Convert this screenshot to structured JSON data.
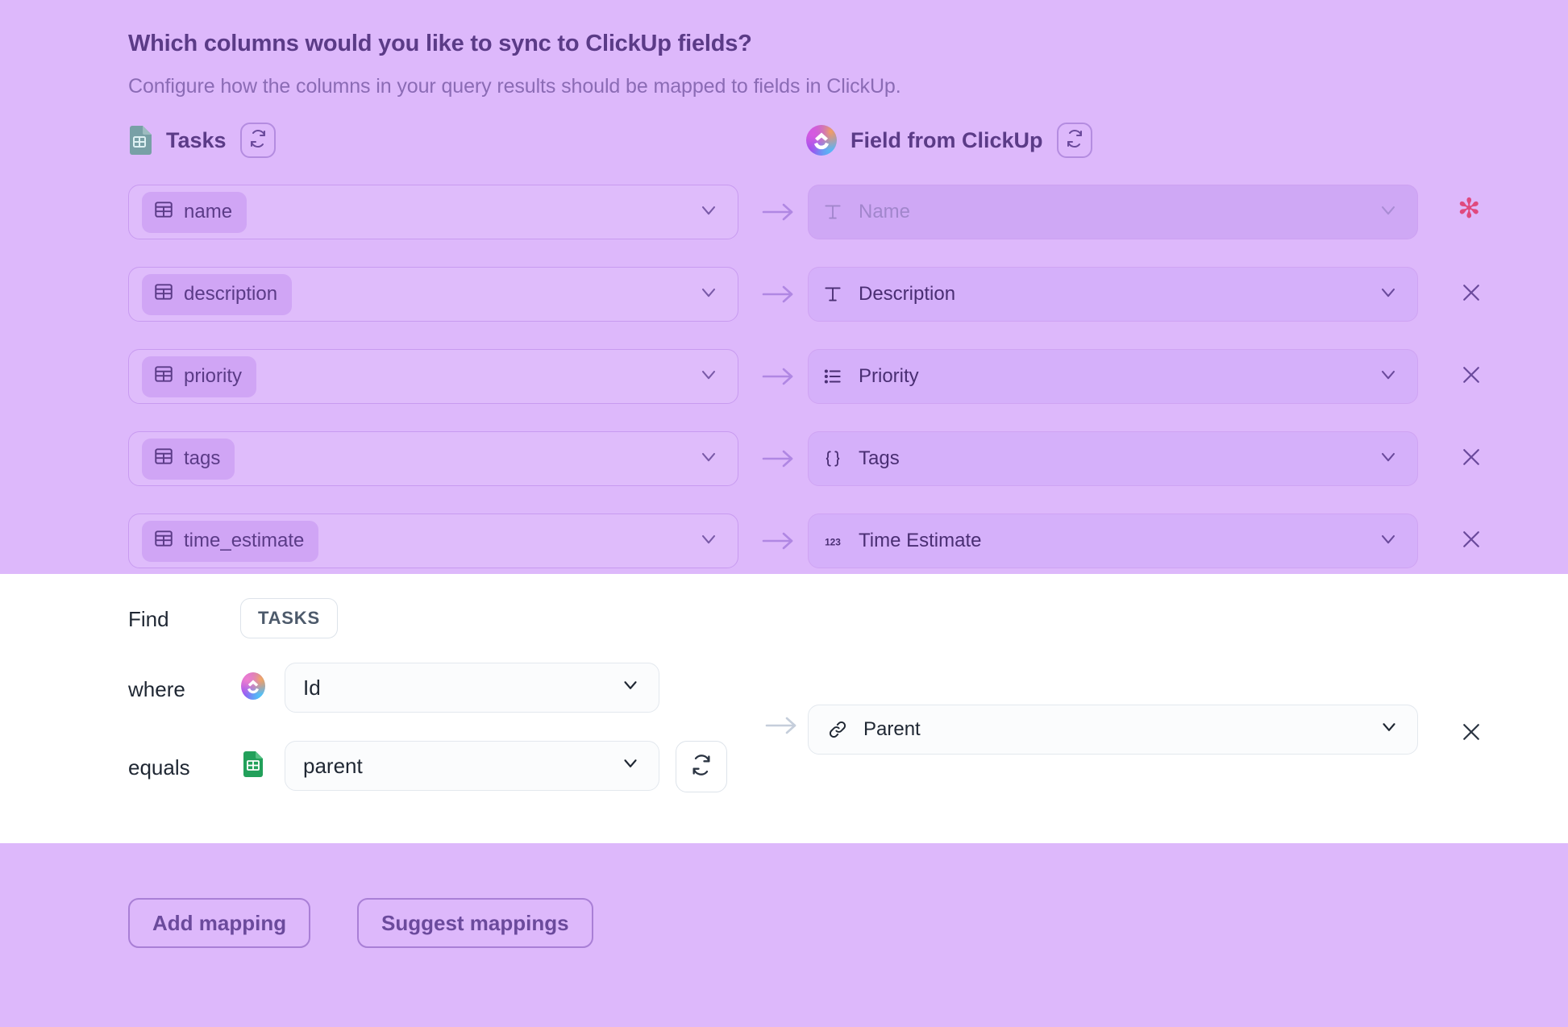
{
  "heading": "Which columns would you like to sync to ClickUp fields?",
  "subheading": "Configure how the columns in your query results should be mapped to fields in ClickUp.",
  "columns": {
    "left": {
      "title": "Tasks",
      "icon": "google-sheets-doc-icon",
      "refresh_icon": "refresh-icon"
    },
    "right": {
      "title": "Field from ClickUp",
      "icon": "clickup-logo-icon",
      "refresh_icon": "refresh-icon"
    }
  },
  "mappings": [
    {
      "source": "name",
      "source_icon": "table-icon",
      "target": "Name",
      "target_icon": "text-type-icon",
      "required": true,
      "disabled": true,
      "remove_icon": "close-icon",
      "arrow_icon": "arrow-right-icon",
      "chevron_icon": "chevron-down-icon"
    },
    {
      "source": "description",
      "source_icon": "table-icon",
      "target": "Description",
      "target_icon": "text-type-icon",
      "required": false,
      "disabled": false,
      "remove_icon": "close-icon",
      "arrow_icon": "arrow-right-icon",
      "chevron_icon": "chevron-down-icon"
    },
    {
      "source": "priority",
      "source_icon": "table-icon",
      "target": "Priority",
      "target_icon": "list-type-icon",
      "required": false,
      "disabled": false,
      "remove_icon": "close-icon",
      "arrow_icon": "arrow-right-icon",
      "chevron_icon": "chevron-down-icon"
    },
    {
      "source": "tags",
      "source_icon": "table-icon",
      "target": "Tags",
      "target_icon": "array-type-icon",
      "required": false,
      "disabled": false,
      "remove_icon": "close-icon",
      "arrow_icon": "arrow-right-icon",
      "chevron_icon": "chevron-down-icon"
    },
    {
      "source": "time_estimate",
      "source_icon": "table-icon",
      "target": "Time Estimate",
      "target_icon": "number-type-icon",
      "required": false,
      "disabled": false,
      "remove_icon": "close-icon",
      "arrow_icon": "arrow-right-icon",
      "chevron_icon": "chevron-down-icon"
    }
  ],
  "required_marker": "✻",
  "query_panel": {
    "find_label": "Find",
    "find_value": "TASKS",
    "where_label": "where",
    "where_value": "Id",
    "where_icon": "clickup-logo-icon",
    "equals_label": "equals",
    "equals_value": "parent",
    "equals_icon": "google-sheets-icon",
    "refresh_icon": "refresh-icon",
    "target_value": "Parent",
    "target_icon": "link-icon",
    "arrow_icon": "arrow-right-icon",
    "remove_icon": "close-icon",
    "chevron_icon": "chevron-down-icon"
  },
  "actions": {
    "add_mapping": "Add mapping",
    "suggest_mappings": "Suggest mappings"
  },
  "colors": {
    "background": "#ddb8fb",
    "panel": "#ffffff",
    "heading_text": "#5b3b87",
    "subheading_text": "#8b6bb5",
    "required_star": "#e0497e",
    "accent_border": "#a97fd6"
  }
}
